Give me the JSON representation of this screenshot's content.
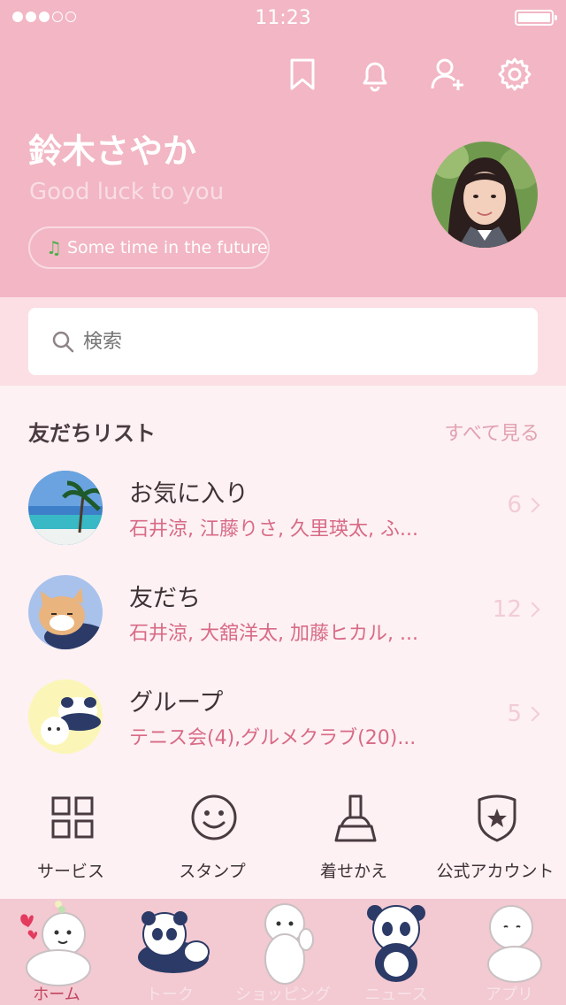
{
  "status_bar": {
    "time": "11:23",
    "signal_dots_filled": 3,
    "signal_dots_total": 5,
    "battery_level": 1.0
  },
  "header": {
    "name": "鈴木さやか",
    "status_message": "Good luck to you",
    "music": "Some time in the future",
    "icons": [
      "bookmark-icon",
      "bell-icon",
      "add-friend-icon",
      "gear-icon"
    ]
  },
  "search": {
    "placeholder": "検索"
  },
  "friends": {
    "title": "友だちリスト",
    "see_all": "すべて見る",
    "rows": [
      {
        "title": "お気に入り",
        "subtitle": "石井涼, 江藤りさ, 久里瑛太, ふ...",
        "count": "6"
      },
      {
        "title": "友だち",
        "subtitle": "石井涼, 大舘洋太, 加藤ヒカル, ...",
        "count": "12"
      },
      {
        "title": "グループ",
        "subtitle": "テニス会(4),グルメクラブ(20)...",
        "count": "5"
      }
    ]
  },
  "services": [
    {
      "label": "サービス",
      "icon": "grid-icon"
    },
    {
      "label": "スタンプ",
      "icon": "smiley-icon"
    },
    {
      "label": "着せかえ",
      "icon": "brush-icon"
    },
    {
      "label": "公式アカウント",
      "icon": "shield-star-icon"
    }
  ],
  "nav": [
    {
      "label": "ホーム",
      "active": true
    },
    {
      "label": "トーク",
      "active": false
    },
    {
      "label": "ショッピング",
      "active": false
    },
    {
      "label": "ニュース",
      "active": false
    },
    {
      "label": "アプリ",
      "active": false
    }
  ],
  "colors": {
    "header_bg": "#f2b6c4",
    "accent": "#d86a86",
    "nav_active": "#c0475f",
    "page_bg": "#fdf1f3"
  }
}
